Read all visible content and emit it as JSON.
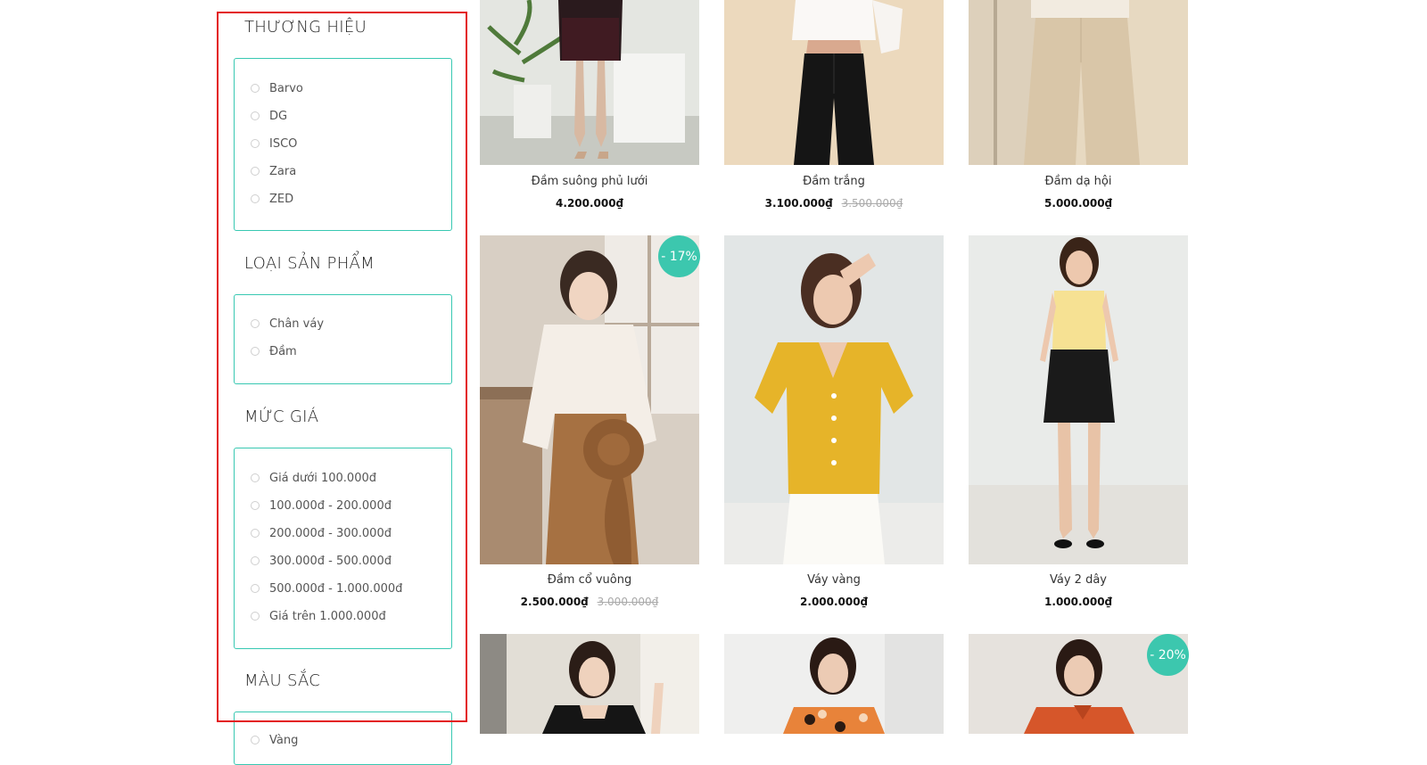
{
  "filters": [
    {
      "title": "THƯƠNG HIỆU",
      "options": [
        "Barvo",
        "DG",
        "ISCO",
        "Zara",
        "ZED"
      ]
    },
    {
      "title": "LOẠI SẢN PHẨM",
      "options": [
        "Chân váy",
        "Đầm"
      ]
    },
    {
      "title": "MỨC GIÁ",
      "options": [
        "Giá dưới 100.000đ",
        "100.000đ - 200.000đ",
        "200.000đ - 300.000đ",
        "300.000đ - 500.000đ",
        "500.000đ - 1.000.000đ",
        "Giá trên 1.000.000đ"
      ]
    },
    {
      "title": "MÀU SẮC",
      "options": [
        "Vàng"
      ]
    }
  ],
  "products": [
    {
      "name": "Đầm suông phủ lưới",
      "price": "4.200.000₫",
      "old_price": "",
      "badge": ""
    },
    {
      "name": "Đầm trắng",
      "price": "3.100.000₫",
      "old_price": "3.500.000₫",
      "badge": ""
    },
    {
      "name": "Đầm dạ hội",
      "price": "5.000.000₫",
      "old_price": "",
      "badge": ""
    },
    {
      "name": "Đầm cổ vuông",
      "price": "2.500.000₫",
      "old_price": "3.000.000₫",
      "badge": "- 17%"
    },
    {
      "name": "Váy vàng",
      "price": "2.000.000₫",
      "old_price": "",
      "badge": ""
    },
    {
      "name": "Váy 2 dây",
      "price": "1.000.000₫",
      "old_price": "",
      "badge": ""
    },
    {
      "name": "",
      "price": "",
      "old_price": "",
      "badge": ""
    },
    {
      "name": "",
      "price": "",
      "old_price": "",
      "badge": ""
    },
    {
      "name": "",
      "price": "",
      "old_price": "",
      "badge": "- 20%"
    }
  ],
  "colors": {
    "accent": "#3cc7ae",
    "highlight": "#e3181b"
  }
}
